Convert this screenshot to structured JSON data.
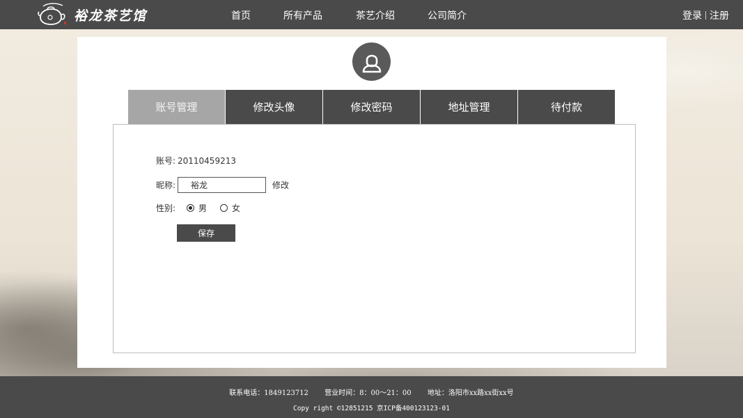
{
  "brand": {
    "name": "裕龙茶艺馆"
  },
  "nav": [
    {
      "label": "首页"
    },
    {
      "label": "所有产品"
    },
    {
      "label": "茶艺介绍"
    },
    {
      "label": "公司简介"
    }
  ],
  "auth": {
    "login": "登录",
    "register": "注册"
  },
  "tabs": [
    {
      "label": "账号管理",
      "active": true
    },
    {
      "label": "修改头像"
    },
    {
      "label": "修改密码"
    },
    {
      "label": "地址管理"
    },
    {
      "label": "待付款"
    }
  ],
  "form": {
    "account_label": "账号:",
    "account_value": "20110459213",
    "nickname_label": "昵称:",
    "nickname_value": "裕龙",
    "modify_label": "修改",
    "gender_label": "性别:",
    "gender_options": [
      "男",
      "女"
    ],
    "gender_selected": "男",
    "save_label": "保存"
  },
  "footer": {
    "phone": "联系电话：1849123712",
    "hours": "营业时间：8：00～21：00",
    "address": "地址：洛阳市xx路xx街xx号",
    "copyright": "Copy right ©12851215 京ICP备400123123-01"
  },
  "colors": {
    "bar": "#4a4a4a",
    "active_tab": "#a6a6a6",
    "page_bg": "#efe8dc"
  }
}
